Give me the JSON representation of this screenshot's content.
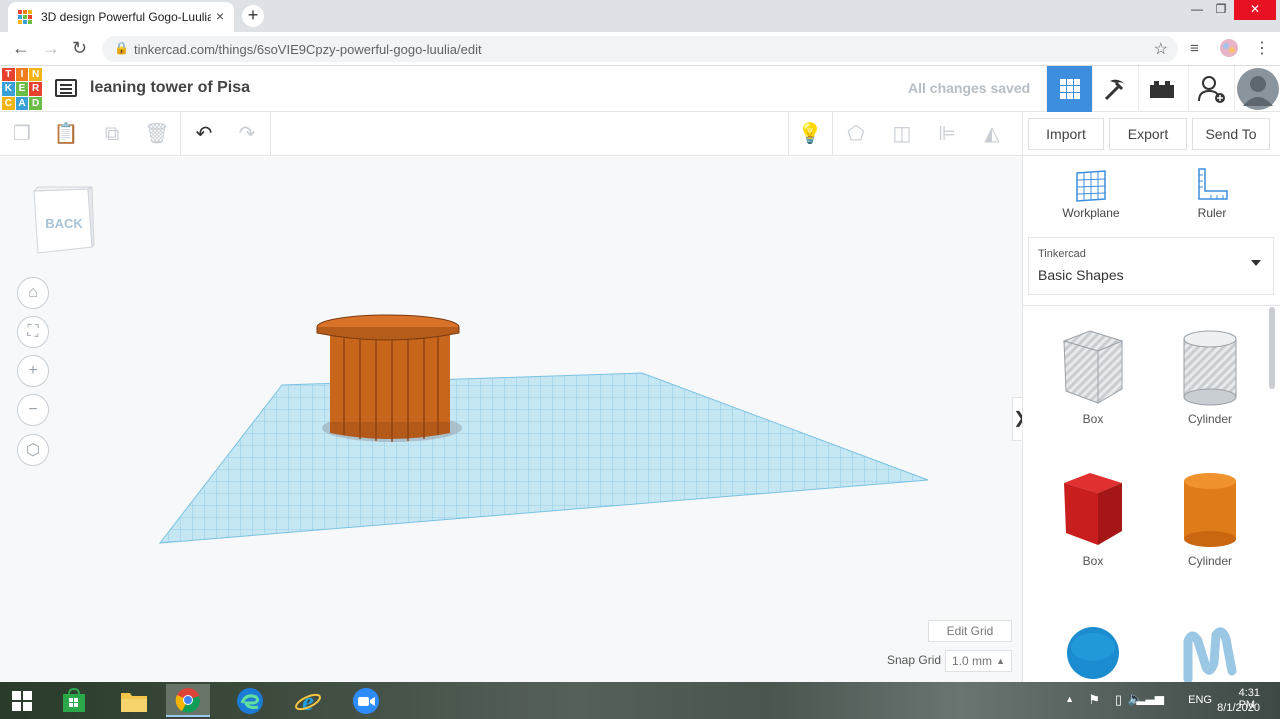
{
  "browser": {
    "tab_title": "3D design Powerful Gogo-Luulia",
    "tab_close": "×",
    "new_tab": "+",
    "url": "tinkercad.com/things/6soVIE9Cpzy-powerful-gogo-luulia/edit",
    "window_controls": [
      "—",
      "❐",
      "✕"
    ]
  },
  "header": {
    "logo_letters": [
      "T",
      "I",
      "N",
      "K",
      "E",
      "R",
      "C",
      "A",
      "D"
    ],
    "logo_colors": [
      "#e8412e",
      "#f07d1e",
      "#f3b416",
      "#3aa1d8",
      "#6bbe45",
      "#e8412e",
      "#f3b416",
      "#3aa1d8",
      "#6bbe45"
    ],
    "design_title": "leaning tower of Pisa",
    "save_status": "All changes saved",
    "active_view_color": "#3d8fde"
  },
  "toolbar": {
    "buttons": [
      "Import",
      "Export",
      "Send To"
    ]
  },
  "viewport": {
    "view_cube_label": "BACK",
    "edit_grid": "Edit Grid",
    "snap_grid_label": "Snap Grid",
    "snap_grid_value": "1.0 mm",
    "collapse_arrow": "❯",
    "object_color": "#d2691e",
    "workplane_color": "#9fd3ea"
  },
  "panel": {
    "workplane_label": "Workplane",
    "ruler_label": "Ruler",
    "library_small": "Tinkercad",
    "library_name": "Basic Shapes",
    "shapes": [
      {
        "label": "Box"
      },
      {
        "label": "Cylinder"
      },
      {
        "label": "Box"
      },
      {
        "label": "Cylinder"
      }
    ]
  },
  "taskbar": {
    "lang": "ENG",
    "time": "4:31 PM",
    "date": "8/1/2020"
  }
}
